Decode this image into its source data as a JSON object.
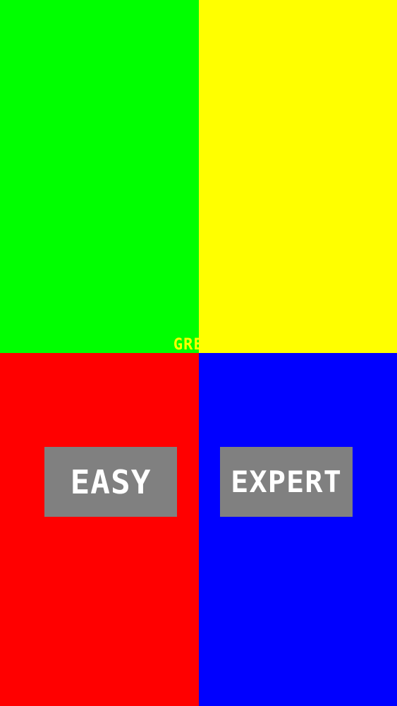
{
  "quadrants": {
    "top_left": {
      "color_name": "green",
      "color": "#00ff00"
    },
    "top_right": {
      "color_name": "yellow",
      "color": "#ffff00"
    },
    "bottom_left": {
      "color_name": "red",
      "color": "#ff0000"
    },
    "bottom_right": {
      "color_name": "blue",
      "color": "#0000ff"
    }
  },
  "target_word": {
    "text": "GREEN",
    "color": "#ffff00"
  },
  "buttons": {
    "easy_label": "EASY",
    "expert_label": "EXPERT",
    "background": "#808080",
    "text_color": "#ffffff"
  }
}
